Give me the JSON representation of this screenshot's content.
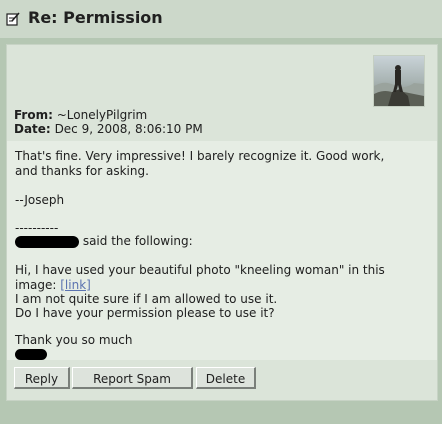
{
  "title": "Re: Permission",
  "icons": {
    "title": "edit-note-icon"
  },
  "meta": {
    "from_label": "From:",
    "from_value": "~LonelyPilgrim",
    "date_label": "Date:",
    "date_value": "Dec 9, 2008, 8:06:10 PM"
  },
  "message": {
    "reply_line1": "That's fine. Very impressive! I barely recognize it. Good work,",
    "reply_line2": "and thanks for asking.",
    "signature": "--Joseph",
    "separator": "----------",
    "said_the_following": "said the following:",
    "quote_line1": "Hi, I have used your beautiful photo \"kneeling woman\" in this",
    "quote_image_label": "image:",
    "quote_link": "[link]",
    "quote_line3": "I am not quite sure if I am allowed to use it.",
    "quote_line4": "Do I have your permission please to use it?",
    "quote_thanks": "Thank you so much"
  },
  "buttons": {
    "reply": "Reply",
    "report_spam": "Report Spam",
    "delete": "Delete"
  }
}
